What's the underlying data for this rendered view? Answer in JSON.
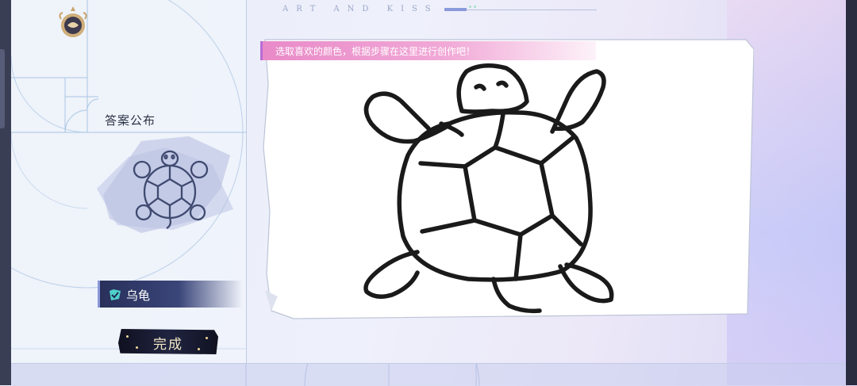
{
  "top_decoration": {
    "text": "ART AND KISS"
  },
  "left_panel": {
    "emblem_icon": "golden-emblem-icon",
    "answer_title": "答案公布",
    "answer_image_icon": "turtle-line-icon",
    "answer_check_icon": "check-icon",
    "answer_word": "乌龟",
    "done_label": "完成"
  },
  "canvas": {
    "prompt": "选取喜欢的颜色，根据步骤在这里进行创作吧！",
    "drawing_icon": "turtle-sketch"
  },
  "colors": {
    "prompt_banner": "#f1a9d7",
    "answer_tag": "#3a4579",
    "check": "#4fd0c8",
    "done_button": "#202440",
    "done_text": "#f4e9c8"
  }
}
